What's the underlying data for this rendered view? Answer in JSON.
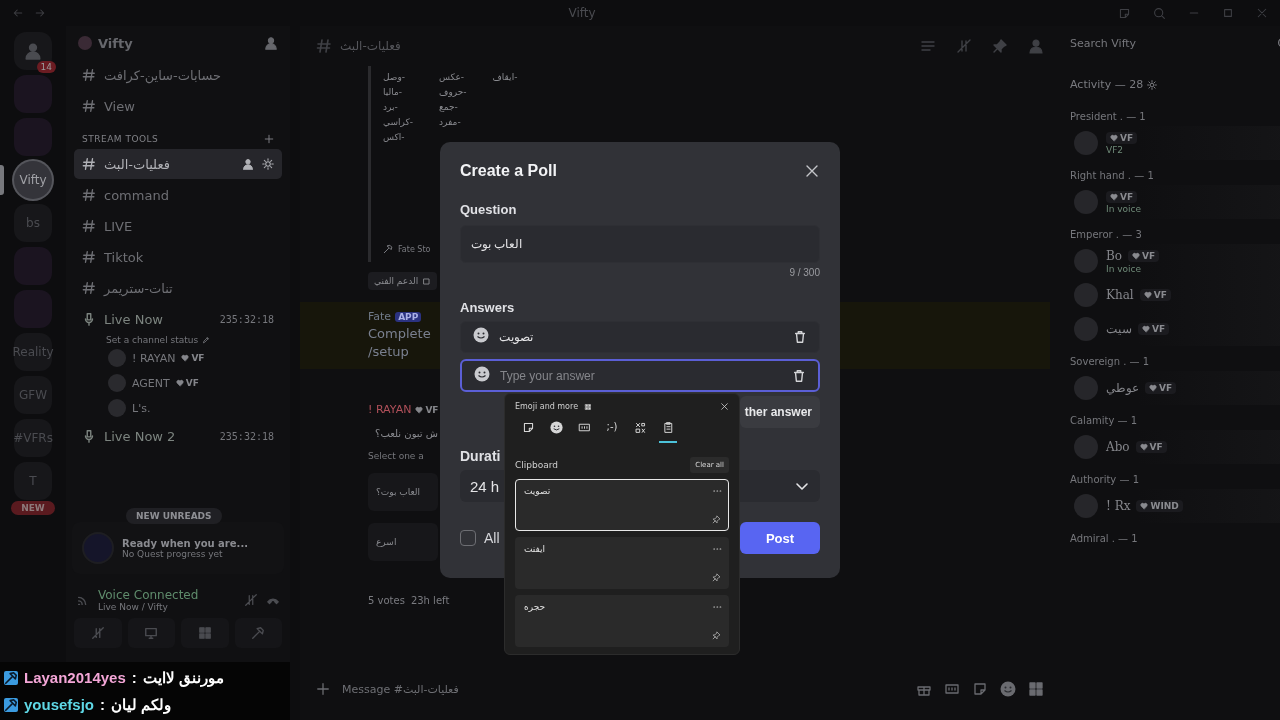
{
  "window": {
    "title": "Vifty"
  },
  "servers": [
    {
      "kind": "logo",
      "badge": "14",
      "selected": false
    },
    {
      "kind": "image",
      "selected": false
    },
    {
      "kind": "image",
      "selected": false
    },
    {
      "kind": "text",
      "label": "Vifty",
      "selected": true
    },
    {
      "kind": "text",
      "label": "bs",
      "selected": false
    },
    {
      "kind": "image",
      "selected": false
    },
    {
      "kind": "image",
      "selected": false
    },
    {
      "kind": "text",
      "label": "Reality",
      "selected": false
    },
    {
      "kind": "text",
      "label": "GFW",
      "selected": false
    },
    {
      "kind": "text",
      "label": "#VFRs",
      "selected": false
    },
    {
      "kind": "text",
      "label": "T",
      "selected": false
    }
  ],
  "new_badge": "NEW",
  "sidebar": {
    "server": "Vifty",
    "items": [
      {
        "kind": "text",
        "name": "حسابات-ساين-كرافت",
        "selected": false
      },
      {
        "kind": "text",
        "name": "View",
        "selected": false
      },
      {
        "kind": "category",
        "name": "STREAM TOOLS"
      },
      {
        "kind": "text",
        "name": "فعليات-البث",
        "selected": true
      },
      {
        "kind": "text",
        "name": "command",
        "selected": false
      },
      {
        "kind": "text",
        "name": "LIVE",
        "selected": false
      },
      {
        "kind": "text",
        "name": "Tiktok",
        "selected": false
      },
      {
        "kind": "text",
        "name": "تنات-ستريمر",
        "selected": false
      },
      {
        "kind": "voice",
        "name": "Live Now",
        "timer": "235:32:18",
        "status": "Set a channel status",
        "members": [
          {
            "name": "! RAYAN",
            "tag": "VF"
          },
          {
            "name": "AGENT",
            "tag": "VF"
          },
          {
            "name": "L's."
          }
        ]
      },
      {
        "kind": "voice",
        "name": "Live Now 2",
        "timer": "235:32:18"
      }
    ],
    "new_unreads": "NEW UNREADS",
    "quest": {
      "title": "Ready when you are...",
      "subtitle": "No Quest progress yet"
    },
    "voice": {
      "title": "Voice Connected",
      "subtitle": "Live Now / Vifty"
    }
  },
  "chat": {
    "channel": "فعليات-البث",
    "search_placeholder": "Search Vifty",
    "embed": {
      "columns": [
        [
          "-ايقاف"
        ],
        [
          "-عكس",
          "-حروف",
          "-جمع",
          "-مفرد"
        ],
        [
          "-وصل",
          "-ماليا",
          "-برد",
          "-كراسي",
          "-اكس"
        ]
      ],
      "footer": "Fate Sto",
      "link": "الدعم الفني"
    },
    "app_message": {
      "author": "Fate",
      "tag": "APP",
      "lines": [
        "Complete",
        "/setup"
      ]
    },
    "poll_message": {
      "author": "! RAYAN",
      "tag": "VF",
      "question": "ش تبون نلعب؟",
      "hint": "Select one a",
      "options": [
        "العاب بوت؟",
        "اسرع"
      ],
      "votes": "5 votes",
      "time": "23h left"
    },
    "input_placeholder": "Message #فعليات-البث"
  },
  "members": {
    "header": "Activity — 28",
    "groups": [
      {
        "title": "President . — 1",
        "members": [
          {
            "tag": "VF",
            "sub": "VF2"
          }
        ]
      },
      {
        "title": "Right hand . — 1",
        "members": [
          {
            "tag": "VF",
            "sub": "In voice"
          }
        ]
      },
      {
        "title": "Emperor . — 3",
        "members": [
          {
            "name": "Bo",
            "tag": "VF",
            "sub": "In voice"
          },
          {
            "name": "Khal",
            "tag": "VF"
          },
          {
            "name": "سيت",
            "tag": "VF"
          }
        ]
      },
      {
        "title": "Sovereign . — 1",
        "members": [
          {
            "name": "عوطي",
            "tag": "VF"
          }
        ]
      },
      {
        "title": "Calamity — 1",
        "members": [
          {
            "name": "Abo",
            "tag": "VF"
          }
        ]
      },
      {
        "title": "Authority — 1",
        "members": [
          {
            "name": "! Rx",
            "tag": "WIND"
          }
        ]
      },
      {
        "title": "Admiral . — 1"
      }
    ]
  },
  "modal": {
    "title": "Create a Poll",
    "question_label": "Question",
    "question_value": "العاب بوت",
    "counter": "9 / 300",
    "answers_label": "Answers",
    "answers": [
      {
        "value": "تصويت",
        "focused": false
      },
      {
        "placeholder": "Type your answer",
        "focused": true
      }
    ],
    "add_answer": "ther answer",
    "duration_label": "Durati",
    "duration_value": "24 h",
    "multiple": {
      "label": "All",
      "checked": false
    },
    "post": "Post"
  },
  "emoji_panel": {
    "title": "Emoji and more",
    "tabs": [
      {
        "kind": "sticker",
        "selected": false
      },
      {
        "kind": "emoji",
        "selected": false
      },
      {
        "kind": "gif",
        "selected": false
      },
      {
        "kind": "kaomoji",
        "label": ";-)",
        "selected": false
      },
      {
        "kind": "symbols",
        "selected": false
      },
      {
        "kind": "clipboard",
        "selected": true
      }
    ],
    "section": "Clipboard",
    "clear": "Clear all",
    "items": [
      {
        "text": "تصويت",
        "selected": true
      },
      {
        "text": "ايفنت",
        "selected": false
      },
      {
        "text": "حجره",
        "selected": false
      }
    ]
  },
  "stream_chat": {
    "separator": ":",
    "messages": [
      {
        "user": "Layan2014yes",
        "color": "#f4a6d7",
        "message": "مورننق لاايت"
      },
      {
        "user": "yousefsjo",
        "color": "#5fd8e6",
        "message": "ولكم ليان"
      }
    ]
  }
}
